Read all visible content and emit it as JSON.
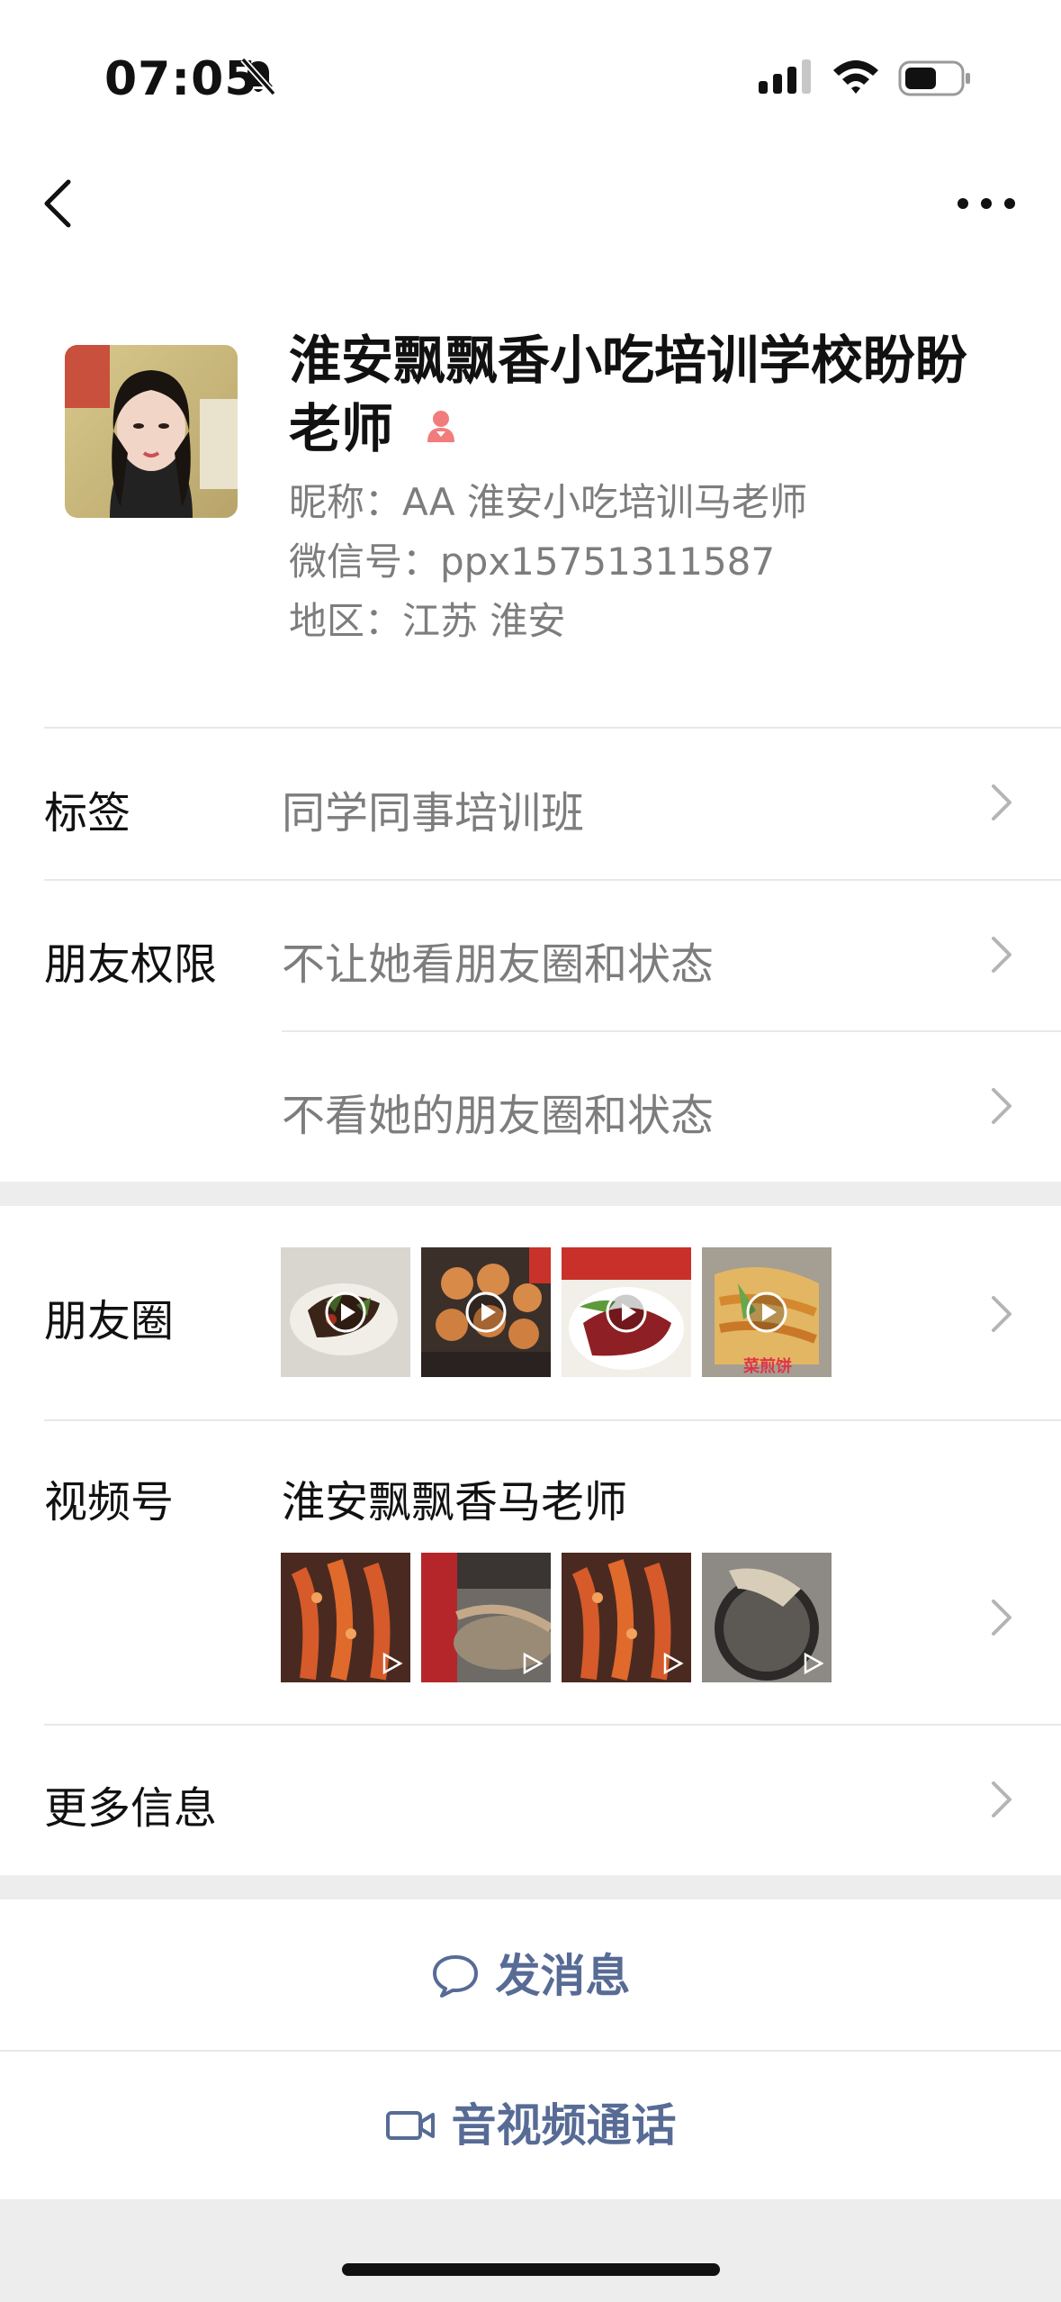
{
  "status_bar": {
    "time": "07:05"
  },
  "profile": {
    "name": "淮安飘飘香小吃培训学校盼盼老师",
    "nickname": "昵称：AA 淮安小吃培训马老师",
    "wechat_id": "微信号：ppx15751311587",
    "region": "地区：江苏 淮安"
  },
  "rows": {
    "tags": {
      "label": "标签",
      "value": "同学同事培训班"
    },
    "permissions": {
      "label": "朋友权限",
      "option1": "不让她看朋友圈和状态",
      "option2": "不看她的朋友圈和状态"
    },
    "moments": {
      "label": "朋友圈"
    },
    "channels": {
      "label": "视频号",
      "channel_name": "淮安飘飘香马老师"
    },
    "more": {
      "label": "更多信息"
    }
  },
  "actions": {
    "message": "发消息",
    "call": "音视频通话"
  },
  "moments_thumbs": [
    {
      "overlay_text": ""
    },
    {
      "overlay_text": ""
    },
    {
      "overlay_text": ""
    },
    {
      "overlay_text": "菜煎饼"
    }
  ],
  "colors": {
    "link_blue": "#576b95",
    "secondary_text": "#7d7d7d",
    "gender_female": "#f27c7c"
  }
}
